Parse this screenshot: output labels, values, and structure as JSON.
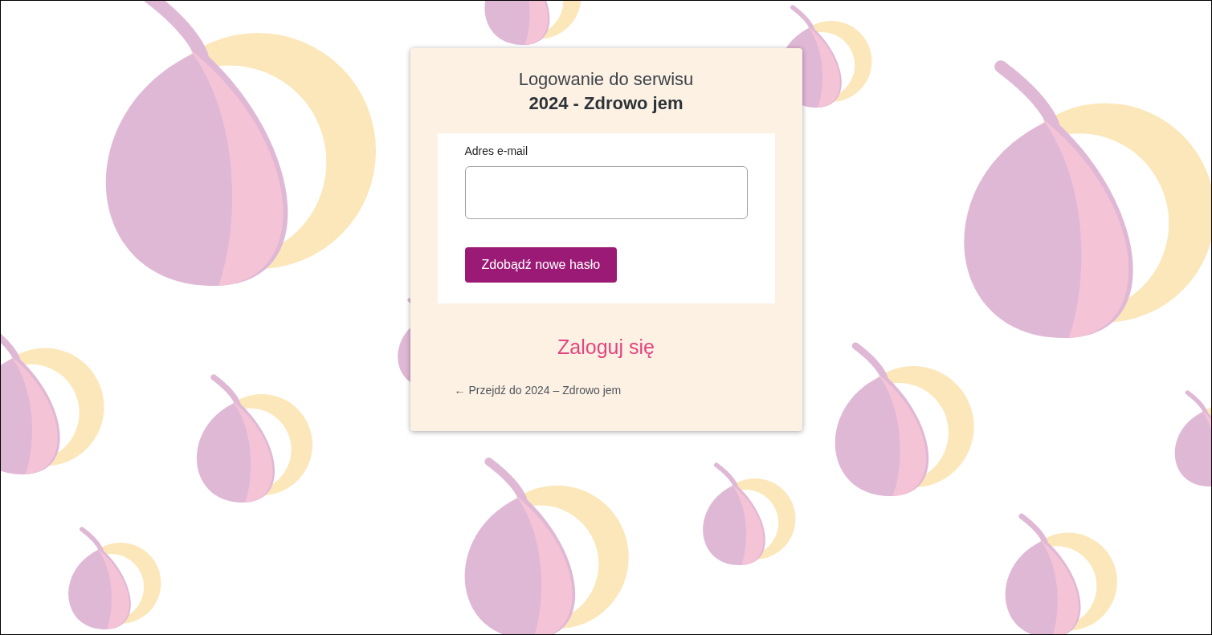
{
  "login_card": {
    "title": "Logowanie do serwisu",
    "site_name": "2024 - Zdrowo jem",
    "email_field": {
      "label": "Adres e-mail"
    },
    "submit_button": "Zdobądź nowe hasło",
    "login_link": "Zaloguj się",
    "back_link": "← Przejdź do 2024 – Zdrowo jem"
  }
}
